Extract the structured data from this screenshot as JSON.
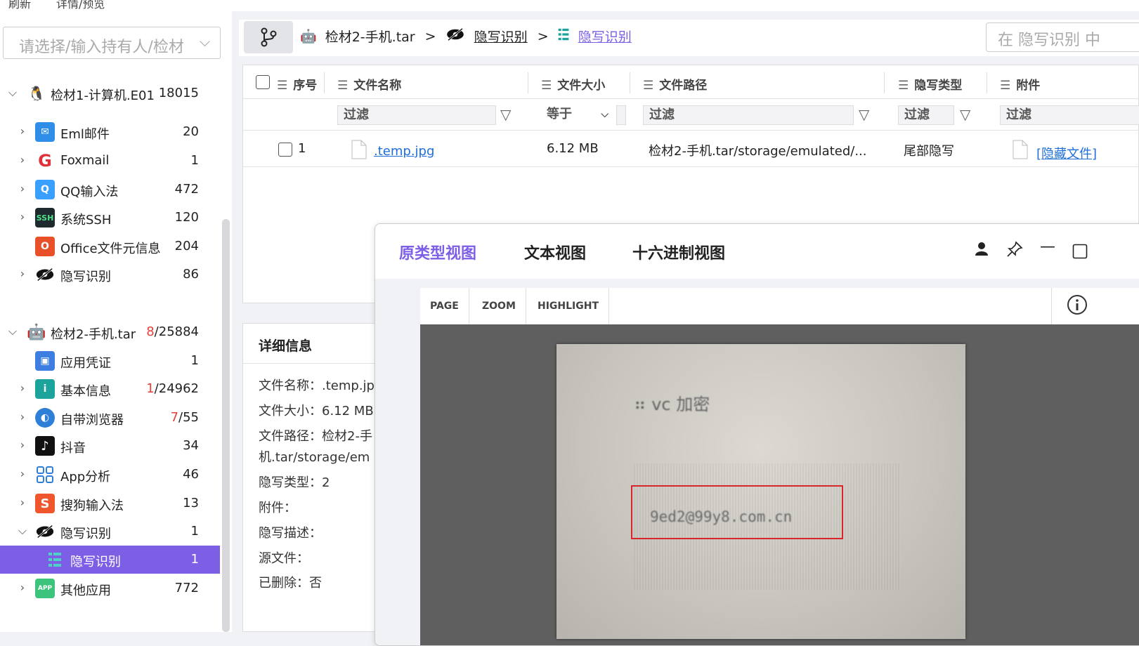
{
  "topmenu": {
    "refresh": "刷新",
    "details": "详情/预览"
  },
  "sidebar": {
    "select_placeholder": "请选择/输入持有人/检材",
    "case1": {
      "label": "检材1-计算机.E01",
      "count": "18015"
    },
    "case1_items": [
      {
        "label": "Eml邮件",
        "count": "20",
        "icon": "mail-icon"
      },
      {
        "label": "Foxmail",
        "count": "1",
        "icon": "foxmail-icon"
      },
      {
        "label": "QQ输入法",
        "count": "472",
        "icon": "qq-input-icon"
      },
      {
        "label": "系统SSH",
        "count": "120",
        "icon": "ssh-icon",
        "icon_text": "SSH"
      },
      {
        "label": "Office文件元信息",
        "count": "204",
        "icon": "office-icon"
      },
      {
        "label": "隐写识别",
        "count": "86",
        "icon": "eye-slash-icon"
      }
    ],
    "case2": {
      "label": "检材2-手机.tar",
      "count_red": "8",
      "count_rest": "/25884"
    },
    "case2_items": [
      {
        "label": "应用凭证",
        "count": "1",
        "icon": "credential-icon"
      },
      {
        "label": "基本信息",
        "count_red": "1",
        "count_rest": "/24962",
        "icon": "info-icon"
      },
      {
        "label": "自带浏览器",
        "count_red": "7",
        "count_rest": "/55",
        "icon": "browser-icon"
      },
      {
        "label": "抖音",
        "count": "34",
        "icon": "douyin-icon"
      },
      {
        "label": "App分析",
        "count": "46",
        "icon": "app-grid-icon"
      },
      {
        "label": "搜狗输入法",
        "count": "13",
        "icon": "sogou-icon"
      },
      {
        "label": "隐写识别",
        "count": "1",
        "icon": "eye-slash-icon"
      },
      {
        "label": "隐写识别",
        "count": "1",
        "icon": "list-icon"
      },
      {
        "label": "其他应用",
        "count": "772",
        "icon": "other-app-icon",
        "icon_text": "APP"
      }
    ]
  },
  "breadcrumb": {
    "item1": "检材2-手机.tar",
    "item2": "隐写识别",
    "item3": "隐写识别",
    "sep": ">"
  },
  "search": {
    "placeholder": "在 隐写识别 中"
  },
  "table": {
    "headers": [
      "序号",
      "文件名称",
      "文件大小",
      "文件路径",
      "隐写类型",
      "附件"
    ],
    "filter_placeholder": "过滤",
    "size_filter": "等于",
    "row": {
      "index": "1",
      "name": ".temp.jpg",
      "size": "6.12 MB",
      "path": "检材2-手机.tar/storage/emulated/...",
      "type": "尾部隐写",
      "attachment": "[隐藏文件]"
    }
  },
  "details": {
    "title": "详细信息",
    "lines": [
      "文件名称：.temp.jpg",
      "文件大小：6.12 MB",
      "文件路径：检材2-手",
      "机.tar/storage/em",
      "隐写类型：2",
      "附件：",
      "隐写描述：",
      "源文件：",
      "已删除：否"
    ]
  },
  "viewer": {
    "tabs": [
      "原类型视图",
      "文本视图",
      "十六进制视图"
    ],
    "toolbar": [
      "PAGE",
      "ZOOM",
      "HIGHLIGHT"
    ],
    "photo_caption": "⠶ vc 加密",
    "photo_email": "9ed2@99y8.com.cn"
  },
  "colors": {
    "accent": "#7d5fe6",
    "red": "#e0413b",
    "link": "#1e6fd9"
  }
}
